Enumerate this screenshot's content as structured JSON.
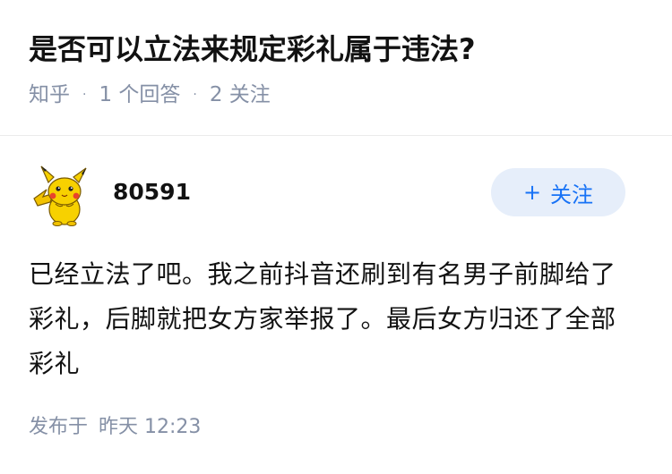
{
  "question": {
    "title": "是否可以立法来规定彩礼属于违法?",
    "source": "知乎",
    "answer_count": "1 个回答",
    "follow_count": "2 关注"
  },
  "answer": {
    "author": {
      "name": "80591",
      "avatar_icon": "pikachu-avatar"
    },
    "follow_button": {
      "label": "关注",
      "icon": "plus-icon"
    },
    "content": "已经立法了吧。我之前抖音还刷到有名男子前脚给了彩礼，后脚就把女方家举报了。最后女方归还了全部彩礼",
    "published_label": "发布于",
    "published_time": "昨天 12:23"
  },
  "colors": {
    "accent": "#1772f6",
    "follow_bg": "#e6eefa",
    "meta_text": "#8590a6",
    "body_text": "#121212"
  }
}
